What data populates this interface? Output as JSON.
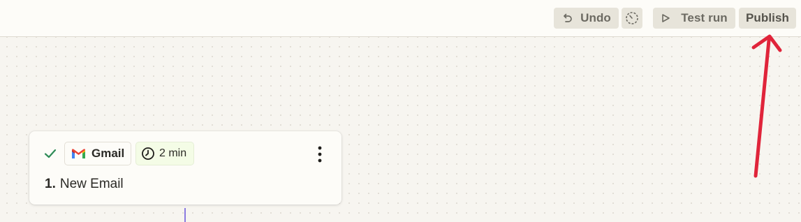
{
  "toolbar": {
    "undo_label": "Undo",
    "test_run_label": "Test run",
    "publish_label": "Publish"
  },
  "step": {
    "app_name": "Gmail",
    "duration": "2 min",
    "number": "1.",
    "title": "New Email",
    "status": "complete"
  },
  "icons": [
    "undo-icon",
    "history-icon",
    "play-icon",
    "check-icon",
    "gmail-logo-icon",
    "clock-icon",
    "more-vertical-icon"
  ],
  "colors": {
    "annotation_arrow": "#e0243a",
    "check": "#2e8b57",
    "connector": "#8a7ae0",
    "duration_chip_bg": "#f4fce6"
  }
}
